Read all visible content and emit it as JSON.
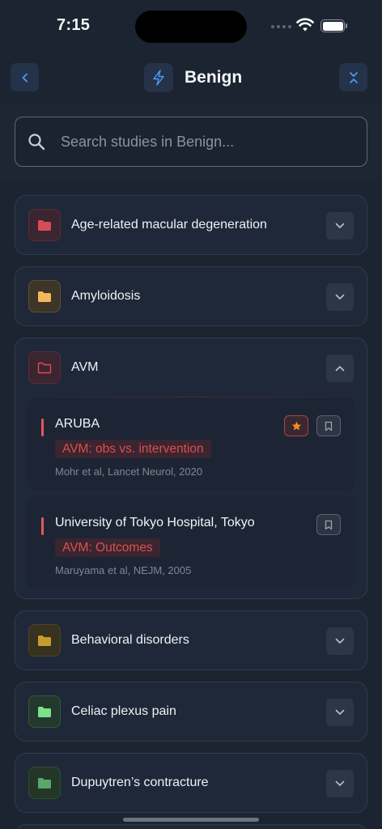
{
  "status_bar": {
    "time": "7:15"
  },
  "header": {
    "title": "Benign"
  },
  "search": {
    "placeholder": "Search studies in Benign..."
  },
  "categories": [
    {
      "label": "Age-related macular degeneration",
      "color": "#d64b5a",
      "expanded": false
    },
    {
      "label": "Amyloidosis",
      "color": "#f4b85a",
      "expanded": false
    },
    {
      "label": "AVM",
      "color": "#e5484d",
      "expanded": true
    },
    {
      "label": "Behavioral disorders",
      "color": "#c99a2e",
      "expanded": false
    },
    {
      "label": "Celiac plexus pain",
      "color": "#7be08a",
      "expanded": false
    },
    {
      "label": "Dupuytren’s contracture",
      "color": "#58a86a",
      "expanded": false
    }
  ],
  "studies": [
    {
      "title": "ARUBA",
      "tag": "AVM: obs vs. intervention",
      "citation": "Mohr et al, Lancet Neurol, 2020",
      "starred": true
    },
    {
      "title": "University of Tokyo Hospital, Tokyo",
      "tag": "AVM: Outcomes",
      "citation": "Maruyama et al, NEJM, 2005",
      "starred": false
    }
  ],
  "colors": {
    "accent": "#3b82f6",
    "tag_text": "#dc4e4e",
    "star": "#f58a1f"
  }
}
